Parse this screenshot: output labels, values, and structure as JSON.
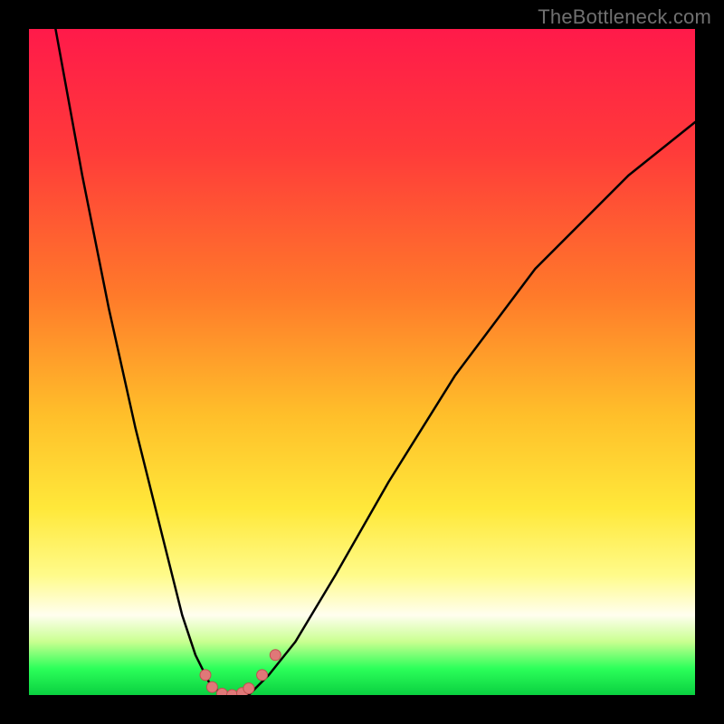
{
  "watermark": "TheBottleneck.com",
  "colors": {
    "frame": "#000000",
    "curve": "#000000",
    "dot_fill": "#e07878",
    "dot_stroke": "#c05050",
    "gradient_stops": [
      "#ff1a4a",
      "#ff3a3a",
      "#ff7a2a",
      "#ffbf2a",
      "#ffe83a",
      "#fffb8a",
      "#fffeef",
      "#c9ff90",
      "#2cff5a",
      "#0ad040"
    ]
  },
  "chart_data": {
    "type": "line",
    "title": "",
    "xlabel": "",
    "ylabel": "",
    "xlim": [
      0,
      100
    ],
    "ylim": [
      0,
      100
    ],
    "grid": false,
    "legend": false,
    "series": [
      {
        "name": "bottleneck-curve",
        "x": [
          4,
          8,
          12,
          16,
          20,
          23,
          25,
          27,
          29,
          30,
          31,
          32,
          33,
          34,
          36,
          40,
          46,
          54,
          64,
          76,
          90,
          100
        ],
        "y": [
          100,
          78,
          58,
          40,
          24,
          12,
          6,
          2,
          0,
          0,
          0,
          0,
          0,
          1,
          3,
          8,
          18,
          32,
          48,
          64,
          78,
          86
        ]
      }
    ],
    "points": [
      {
        "name": "dot-1",
        "x": 26.5,
        "y": 3.0
      },
      {
        "name": "dot-2",
        "x": 27.5,
        "y": 1.2
      },
      {
        "name": "dot-3",
        "x": 29.0,
        "y": 0.2
      },
      {
        "name": "dot-4",
        "x": 30.5,
        "y": 0.0
      },
      {
        "name": "dot-5",
        "x": 32.0,
        "y": 0.3
      },
      {
        "name": "dot-6",
        "x": 33.0,
        "y": 1.0
      },
      {
        "name": "dot-7",
        "x": 35.0,
        "y": 3.0
      },
      {
        "name": "dot-8",
        "x": 37.0,
        "y": 6.0
      }
    ]
  }
}
